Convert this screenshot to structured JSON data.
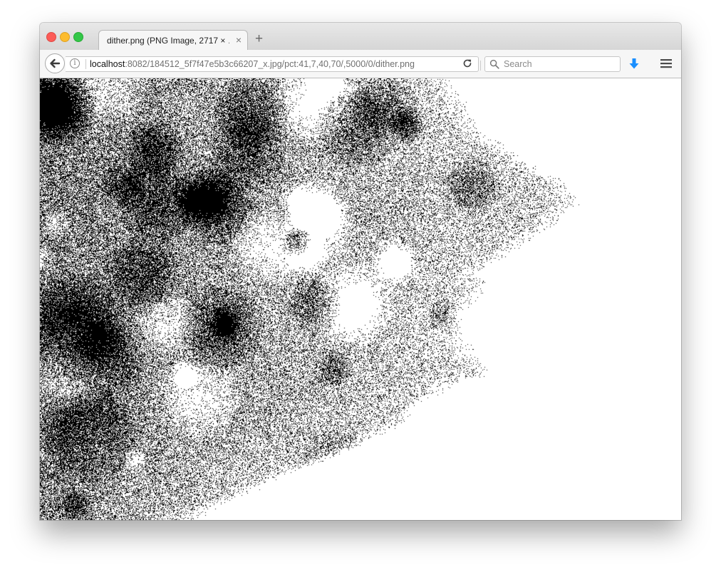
{
  "window": {
    "tab": {
      "title": "dither.png (PNG Image, 2717 × …",
      "close_glyph": "×"
    },
    "new_tab_glyph": "+"
  },
  "navbar": {
    "url_host": "localhost",
    "url_path": ":8082/184512_5f7f47e5b3c66207_x.jpg/pct:41,7,40,70/,5000/0/dither.png",
    "info_glyph": "i",
    "search_placeholder": "Search"
  },
  "colors": {
    "download_accent": "#1a8fff",
    "close": "#fc5b57",
    "minimize": "#fdbc2e",
    "maximize": "#33c748"
  },
  "icons": {
    "back": "back-arrow-icon",
    "info": "info-icon",
    "reload": "reload-icon",
    "search": "search-icon",
    "download": "download-arrow-icon",
    "menu": "hamburger-menu-icon"
  },
  "content": {
    "image_description": "dithered black and white image"
  }
}
